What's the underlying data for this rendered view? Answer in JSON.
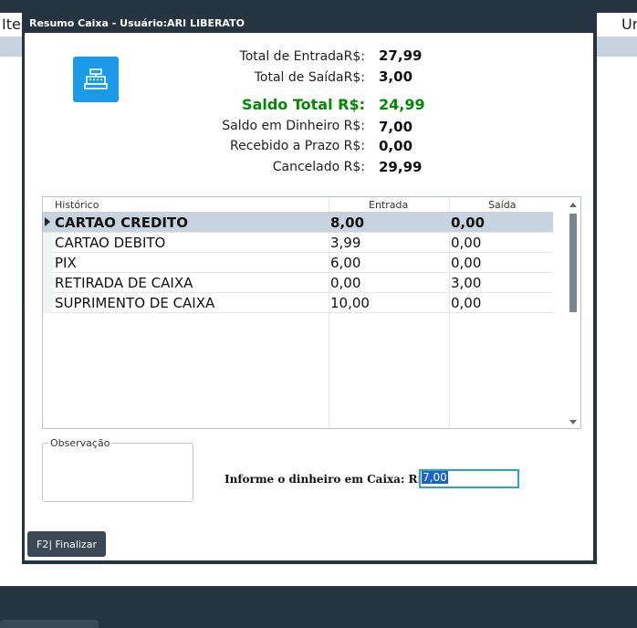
{
  "background": {
    "left_label": "Ite",
    "right_label": "Ur"
  },
  "dialog": {
    "title": "Resumo Caixa - Usuário:ARI LIBERATO",
    "icon": "cash-register-icon",
    "accent_color": "#1a9ae8"
  },
  "summary": [
    {
      "label": "Total de EntradaR$:",
      "value": "27,99"
    },
    {
      "label": "Total de SaídaR$:",
      "value": "3,00"
    },
    {
      "label": "Saldo Total R$:",
      "value": "24,99",
      "highlight_color": "#008a00"
    },
    {
      "label": "Saldo em Dinheiro R$:",
      "value": "7,00"
    },
    {
      "label": "Recebido a Prazo R$:",
      "value": "0,00"
    },
    {
      "label": "Cancelado R$:",
      "value": "29,99"
    }
  ],
  "grid": {
    "columns": [
      "Histórico",
      "Entrada",
      "Saída"
    ],
    "rows": [
      {
        "historico": "CARTAO CREDITO",
        "entrada": "8,00",
        "saida": "0,00",
        "selected": true
      },
      {
        "historico": "CARTAO DEBITO",
        "entrada": "3,99",
        "saida": "0,00"
      },
      {
        "historico": "PIX",
        "entrada": "6,00",
        "saida": "0,00"
      },
      {
        "historico": "RETIRADA DE CAIXA",
        "entrada": "0,00",
        "saida": "3,00"
      },
      {
        "historico": "SUPRIMENTO DE CAIXA",
        "entrada": "10,00",
        "saida": "0,00"
      }
    ]
  },
  "observation": {
    "label": "Observação",
    "value": ""
  },
  "cash": {
    "label": "Informe o dinheiro em Caixa: R$",
    "value": "7,00"
  },
  "buttons": {
    "finish_label": "F2| Finalizar"
  }
}
